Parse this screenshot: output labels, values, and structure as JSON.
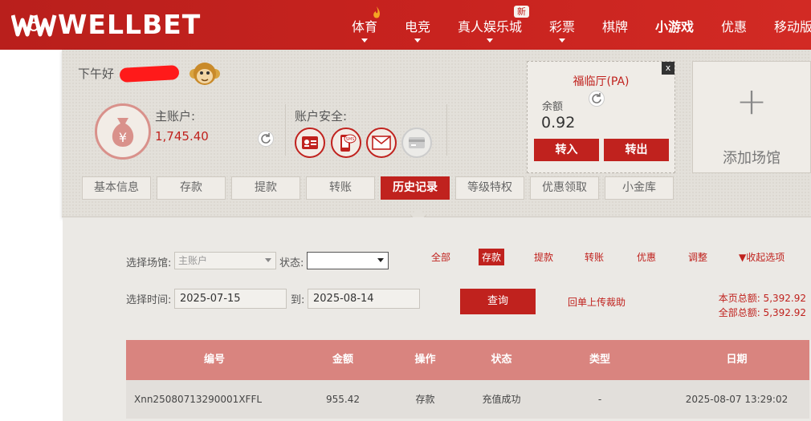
{
  "brand": {
    "name": "WELLBET"
  },
  "nav": {
    "items": [
      "体育",
      "电竞",
      "真人娱乐城",
      "彩票",
      "棋牌",
      "小游戏",
      "优惠",
      "移动版"
    ],
    "new_badge": "新"
  },
  "account": {
    "greeting": "下午好",
    "main_label": "主账户:",
    "main_amount": "1,745.40",
    "security_label": "账户安全:",
    "sms_text": "SMS"
  },
  "tabs": [
    "基本信息",
    "存款",
    "提款",
    "转账",
    "历史记录",
    "等级特权",
    "优惠领取",
    "小金库"
  ],
  "venue": {
    "title": "福临厅(PA)",
    "close": "x",
    "balance_label": "余额",
    "balance": "0.92",
    "transfer_in": "转入",
    "transfer_out": "转出"
  },
  "add_venue": {
    "plus": "+",
    "label": "添加场馆"
  },
  "filters": {
    "venue_label": "选择场馆:",
    "venue_value": "主账户",
    "status_label": "状态:",
    "types": [
      "全部",
      "存款",
      "提款",
      "转账",
      "优惠",
      "调整"
    ],
    "collapse": "▼收起选项",
    "time_label": "选择时间:",
    "date_from": "2025-07-15",
    "to_label": "到:",
    "date_to": "2025-08-14",
    "query": "查询",
    "upload": "回单上传裁助",
    "page_total": "本页总额: 5,392.92",
    "all_total": "全部总额: 5,392.92"
  },
  "table": {
    "headers": [
      "编号",
      "金额",
      "操作",
      "状态",
      "类型",
      "日期"
    ],
    "rows": [
      [
        "Xnn25080713290001XFFL",
        "955.42",
        "存款",
        "充值成功",
        "-",
        "2025-08-07 13:29:02"
      ]
    ]
  },
  "colors": {
    "brand_red": "#c0221e",
    "header_red": "#d9847f"
  }
}
